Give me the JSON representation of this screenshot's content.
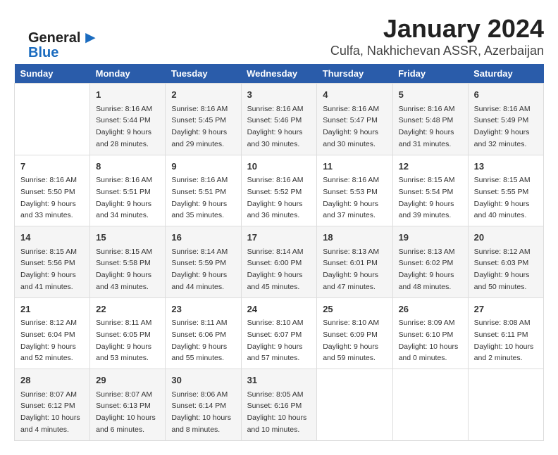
{
  "logo": {
    "general": "General",
    "blue": "Blue"
  },
  "header": {
    "title": "January 2024",
    "subtitle": "Culfa, Nakhichevan ASSR, Azerbaijan"
  },
  "weekdays": [
    "Sunday",
    "Monday",
    "Tuesday",
    "Wednesday",
    "Thursday",
    "Friday",
    "Saturday"
  ],
  "weeks": [
    [
      {
        "day": "",
        "sunrise": "",
        "sunset": "",
        "daylight": ""
      },
      {
        "day": "1",
        "sunrise": "Sunrise: 8:16 AM",
        "sunset": "Sunset: 5:44 PM",
        "daylight": "Daylight: 9 hours and 28 minutes."
      },
      {
        "day": "2",
        "sunrise": "Sunrise: 8:16 AM",
        "sunset": "Sunset: 5:45 PM",
        "daylight": "Daylight: 9 hours and 29 minutes."
      },
      {
        "day": "3",
        "sunrise": "Sunrise: 8:16 AM",
        "sunset": "Sunset: 5:46 PM",
        "daylight": "Daylight: 9 hours and 30 minutes."
      },
      {
        "day": "4",
        "sunrise": "Sunrise: 8:16 AM",
        "sunset": "Sunset: 5:47 PM",
        "daylight": "Daylight: 9 hours and 30 minutes."
      },
      {
        "day": "5",
        "sunrise": "Sunrise: 8:16 AM",
        "sunset": "Sunset: 5:48 PM",
        "daylight": "Daylight: 9 hours and 31 minutes."
      },
      {
        "day": "6",
        "sunrise": "Sunrise: 8:16 AM",
        "sunset": "Sunset: 5:49 PM",
        "daylight": "Daylight: 9 hours and 32 minutes."
      }
    ],
    [
      {
        "day": "7",
        "sunrise": "Sunrise: 8:16 AM",
        "sunset": "Sunset: 5:50 PM",
        "daylight": "Daylight: 9 hours and 33 minutes."
      },
      {
        "day": "8",
        "sunrise": "Sunrise: 8:16 AM",
        "sunset": "Sunset: 5:51 PM",
        "daylight": "Daylight: 9 hours and 34 minutes."
      },
      {
        "day": "9",
        "sunrise": "Sunrise: 8:16 AM",
        "sunset": "Sunset: 5:51 PM",
        "daylight": "Daylight: 9 hours and 35 minutes."
      },
      {
        "day": "10",
        "sunrise": "Sunrise: 8:16 AM",
        "sunset": "Sunset: 5:52 PM",
        "daylight": "Daylight: 9 hours and 36 minutes."
      },
      {
        "day": "11",
        "sunrise": "Sunrise: 8:16 AM",
        "sunset": "Sunset: 5:53 PM",
        "daylight": "Daylight: 9 hours and 37 minutes."
      },
      {
        "day": "12",
        "sunrise": "Sunrise: 8:15 AM",
        "sunset": "Sunset: 5:54 PM",
        "daylight": "Daylight: 9 hours and 39 minutes."
      },
      {
        "day": "13",
        "sunrise": "Sunrise: 8:15 AM",
        "sunset": "Sunset: 5:55 PM",
        "daylight": "Daylight: 9 hours and 40 minutes."
      }
    ],
    [
      {
        "day": "14",
        "sunrise": "Sunrise: 8:15 AM",
        "sunset": "Sunset: 5:56 PM",
        "daylight": "Daylight: 9 hours and 41 minutes."
      },
      {
        "day": "15",
        "sunrise": "Sunrise: 8:15 AM",
        "sunset": "Sunset: 5:58 PM",
        "daylight": "Daylight: 9 hours and 43 minutes."
      },
      {
        "day": "16",
        "sunrise": "Sunrise: 8:14 AM",
        "sunset": "Sunset: 5:59 PM",
        "daylight": "Daylight: 9 hours and 44 minutes."
      },
      {
        "day": "17",
        "sunrise": "Sunrise: 8:14 AM",
        "sunset": "Sunset: 6:00 PM",
        "daylight": "Daylight: 9 hours and 45 minutes."
      },
      {
        "day": "18",
        "sunrise": "Sunrise: 8:13 AM",
        "sunset": "Sunset: 6:01 PM",
        "daylight": "Daylight: 9 hours and 47 minutes."
      },
      {
        "day": "19",
        "sunrise": "Sunrise: 8:13 AM",
        "sunset": "Sunset: 6:02 PM",
        "daylight": "Daylight: 9 hours and 48 minutes."
      },
      {
        "day": "20",
        "sunrise": "Sunrise: 8:12 AM",
        "sunset": "Sunset: 6:03 PM",
        "daylight": "Daylight: 9 hours and 50 minutes."
      }
    ],
    [
      {
        "day": "21",
        "sunrise": "Sunrise: 8:12 AM",
        "sunset": "Sunset: 6:04 PM",
        "daylight": "Daylight: 9 hours and 52 minutes."
      },
      {
        "day": "22",
        "sunrise": "Sunrise: 8:11 AM",
        "sunset": "Sunset: 6:05 PM",
        "daylight": "Daylight: 9 hours and 53 minutes."
      },
      {
        "day": "23",
        "sunrise": "Sunrise: 8:11 AM",
        "sunset": "Sunset: 6:06 PM",
        "daylight": "Daylight: 9 hours and 55 minutes."
      },
      {
        "day": "24",
        "sunrise": "Sunrise: 8:10 AM",
        "sunset": "Sunset: 6:07 PM",
        "daylight": "Daylight: 9 hours and 57 minutes."
      },
      {
        "day": "25",
        "sunrise": "Sunrise: 8:10 AM",
        "sunset": "Sunset: 6:09 PM",
        "daylight": "Daylight: 9 hours and 59 minutes."
      },
      {
        "day": "26",
        "sunrise": "Sunrise: 8:09 AM",
        "sunset": "Sunset: 6:10 PM",
        "daylight": "Daylight: 10 hours and 0 minutes."
      },
      {
        "day": "27",
        "sunrise": "Sunrise: 8:08 AM",
        "sunset": "Sunset: 6:11 PM",
        "daylight": "Daylight: 10 hours and 2 minutes."
      }
    ],
    [
      {
        "day": "28",
        "sunrise": "Sunrise: 8:07 AM",
        "sunset": "Sunset: 6:12 PM",
        "daylight": "Daylight: 10 hours and 4 minutes."
      },
      {
        "day": "29",
        "sunrise": "Sunrise: 8:07 AM",
        "sunset": "Sunset: 6:13 PM",
        "daylight": "Daylight: 10 hours and 6 minutes."
      },
      {
        "day": "30",
        "sunrise": "Sunrise: 8:06 AM",
        "sunset": "Sunset: 6:14 PM",
        "daylight": "Daylight: 10 hours and 8 minutes."
      },
      {
        "day": "31",
        "sunrise": "Sunrise: 8:05 AM",
        "sunset": "Sunset: 6:16 PM",
        "daylight": "Daylight: 10 hours and 10 minutes."
      },
      {
        "day": "",
        "sunrise": "",
        "sunset": "",
        "daylight": ""
      },
      {
        "day": "",
        "sunrise": "",
        "sunset": "",
        "daylight": ""
      },
      {
        "day": "",
        "sunrise": "",
        "sunset": "",
        "daylight": ""
      }
    ]
  ]
}
